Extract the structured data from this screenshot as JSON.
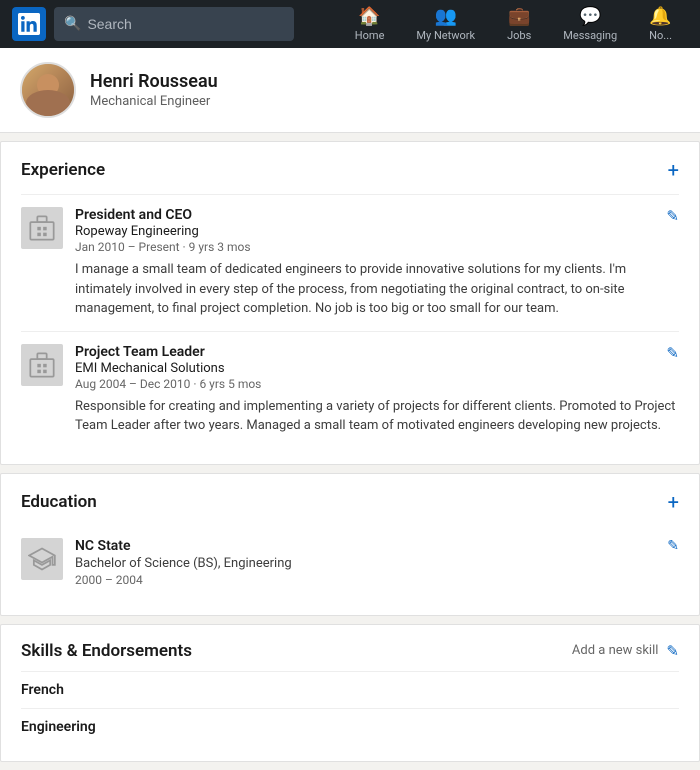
{
  "navbar": {
    "logo_alt": "LinkedIn",
    "search_placeholder": "Search",
    "nav_items": [
      {
        "id": "home",
        "label": "Home",
        "icon": "🏠"
      },
      {
        "id": "network",
        "label": "My Network",
        "icon": "👥"
      },
      {
        "id": "jobs",
        "label": "Jobs",
        "icon": "💼"
      },
      {
        "id": "messaging",
        "label": "Messaging",
        "icon": "💬"
      },
      {
        "id": "notifications",
        "label": "No...",
        "icon": "🔔"
      }
    ]
  },
  "profile": {
    "name": "Henri Rousseau",
    "title": "Mechanical Engineer"
  },
  "experience": {
    "section_title": "Experience",
    "items": [
      {
        "id": "exp1",
        "job_title": "President and CEO",
        "company": "Ropeway Engineering",
        "date_range": "Jan 2010 – Present · 9 yrs 3 mos",
        "description": "I manage a small team of dedicated engineers to provide innovative solutions for my clients. I'm intimately involved in every step of the process, from negotiating the original contract, to on-site management, to final project completion. No job is too big or too small for our team."
      },
      {
        "id": "exp2",
        "job_title": "Project Team Leader",
        "company": "EMI Mechanical Solutions",
        "date_range": "Aug 2004 – Dec 2010 · 6 yrs 5 mos",
        "description": "Responsible for creating and implementing a variety of projects for different clients. Promoted to Project Team Leader after two years. Managed a small team of motivated engineers developing new projects."
      }
    ]
  },
  "education": {
    "section_title": "Education",
    "items": [
      {
        "id": "edu1",
        "school": "NC State",
        "degree": "Bachelor of Science (BS), Engineering",
        "years": "2000 – 2004"
      }
    ]
  },
  "skills": {
    "section_title": "Skills & Endorsements",
    "add_label": "Add a new skill",
    "items": [
      {
        "id": "skill1",
        "name": "French"
      },
      {
        "id": "skill2",
        "name": "Engineering"
      }
    ]
  },
  "icons": {
    "search": "🔍",
    "plus": "+",
    "edit": "✎",
    "building": "🏢",
    "school": "🏛"
  }
}
